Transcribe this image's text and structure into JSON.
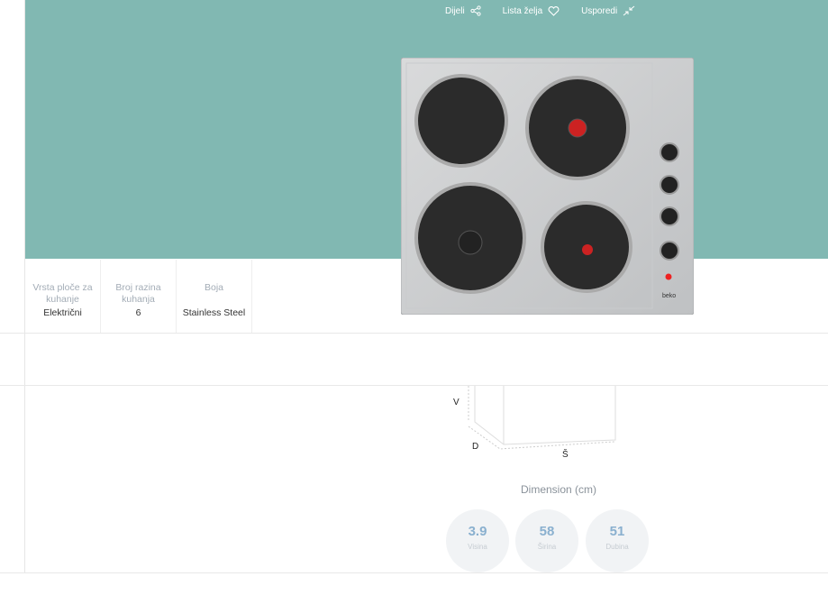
{
  "actions": [
    {
      "label": "Dijeli",
      "icon": "share-icon"
    },
    {
      "label": "Lista želja",
      "icon": "heart-icon"
    },
    {
      "label": "Usporedi",
      "icon": "compare-icon"
    }
  ],
  "specs": [
    {
      "label": "Vrsta ploče za kuhanje",
      "value": "Električni"
    },
    {
      "label": "Broj razina kuhanja",
      "value": "6"
    },
    {
      "label": "Boja",
      "value": "Stainless Steel"
    }
  ],
  "product": {
    "brand": "beko"
  },
  "dimensions": {
    "axis_labels": {
      "height": "V",
      "depth": "D",
      "width": "Š"
    },
    "title": "Dimension (cm)",
    "items": [
      {
        "value": "3.9",
        "label": "Visina"
      },
      {
        "value": "58",
        "label": "Širina"
      },
      {
        "value": "51",
        "label": "Dubina"
      }
    ]
  },
  "colors": {
    "hero": "#81b8b2",
    "accent": "#8ab0cf"
  }
}
